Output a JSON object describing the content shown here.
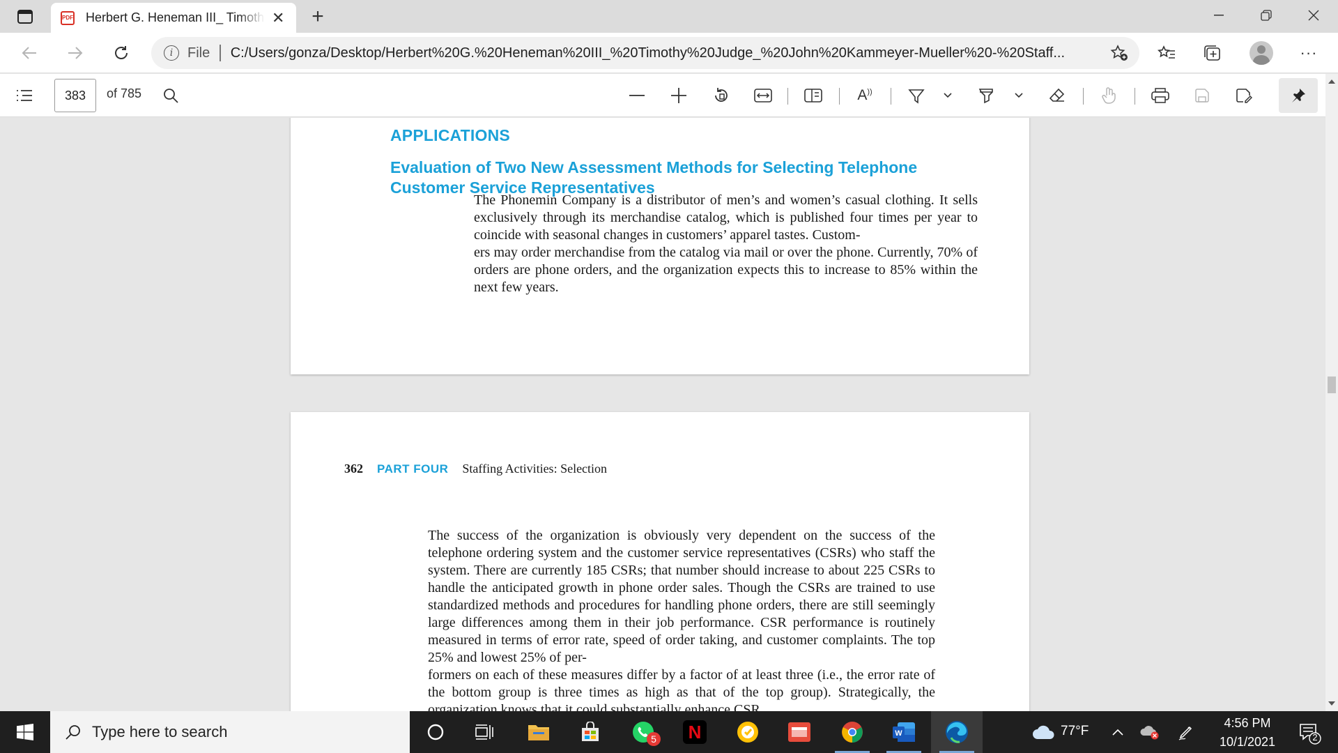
{
  "browser": {
    "tab": {
      "title": "Herbert G. Heneman III_ Timothy Judge_ John Kammeyer-Mueller - Staffing Organizations",
      "icon": "pdf-icon"
    },
    "address_bar": {
      "scheme_label": "File",
      "url": "C:/Users/gonza/Desktop/Herbert%20G.%20Heneman%20III_%20Timothy%20Judge_%20John%20Kammeyer-Mueller%20-%20Staff..."
    }
  },
  "pdf_toolbar": {
    "current_page": "383",
    "total_pages": "of 785"
  },
  "document": {
    "page1": {
      "section_heading": "APPLICATIONS",
      "subheading": "Evaluation of Two New Assessment Methods for Selecting Telephone Customer Service Representatives",
      "paragraph": "The Phonemin Company is a distributor of men’s and women’s casual clothing. It sells exclusively through its merchandise catalog, which is published four times per year to coincide with seasonal changes in customers’ apparel tastes. Custom-\ners may order merchandise from the catalog via mail or over the phone. Currently, 70% of orders are phone orders, and the organization expects this to increase to 85% within the next few years."
    },
    "page2": {
      "page_number": "362",
      "part_label": "PART FOUR",
      "part_title": "Staffing Activities: Selection",
      "paragraph": "     The success of the organization is obviously very dependent on the success of the telephone ordering system and the customer service representatives (CSRs) who staff the system. There are currently 185 CSRs; that number should increase to about 225 CSRs to handle the anticipated growth in phone order sales. Though the CSRs are trained to use standardized methods and procedures for handling phone orders, there are still seemingly large differences among them in their job performance. CSR performance is routinely measured in terms of error rate, speed of order taking, and customer complaints. The top 25% and lowest 25% of per-\nformers on each of these measures differ by a factor of at least three (i.e., the error rate of the bottom group is three times as high as that of the top group). Strategically, the organization knows that it could substantially enhance CSR"
    }
  },
  "taskbar": {
    "search_placeholder": "Type here to search",
    "whatsapp_badge": "5",
    "weather": "77°F",
    "time": "4:56 PM",
    "date": "10/1/2021",
    "notification_count": "2"
  },
  "colors": {
    "accent_heading": "#1ba1d8",
    "taskbar": "#1f1f1f",
    "viewer_bg": "#e6e6e6"
  }
}
